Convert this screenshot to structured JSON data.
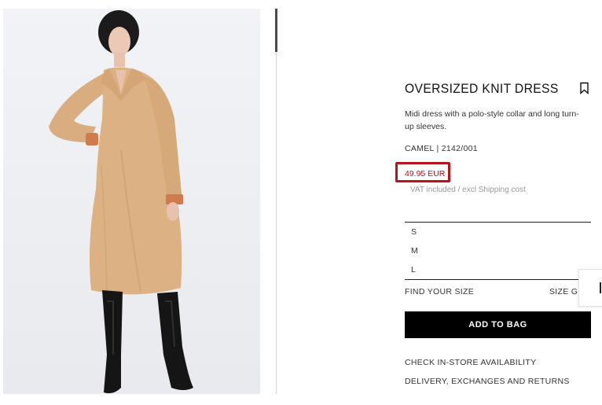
{
  "product": {
    "title": "OVERSIZED KNIT DRESS",
    "description": "Midi dress with a polo-style collar and long turn-up sleeves.",
    "reference": "CAMEL | 2142/001",
    "price": "49.95 EUR",
    "vat_note": "VAT included / excl Shipping cost",
    "bookmark_icon": "bookmark-icon",
    "price_highlight_color": "#b8141b"
  },
  "sizes": {
    "items": [
      "S",
      "M",
      "L"
    ]
  },
  "size_tools": {
    "find_size": "FIND YOUR SIZE",
    "size_guide": "SIZE GUIDE"
  },
  "actions": {
    "add_to_bag": "ADD TO BAG",
    "check_store": "CHECK IN-STORE AVAILABILITY",
    "delivery": "DELIVERY, EXCHANGES AND RETURNS"
  },
  "colors": {
    "dress": "#dcb184",
    "cuff_accent": "#d07a4e",
    "button_bg": "#000000"
  }
}
